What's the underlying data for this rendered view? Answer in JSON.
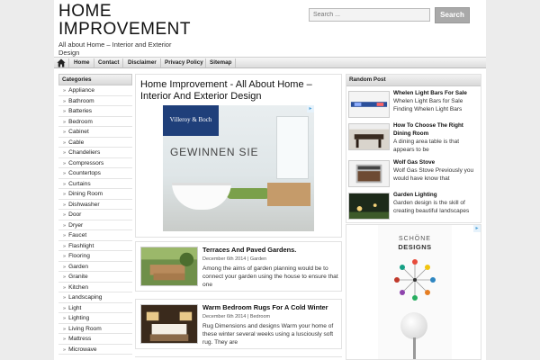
{
  "header": {
    "site_title": "HOME IMPROVEMENT",
    "tagline": "All about Home – Interior and Exterior Design"
  },
  "search": {
    "placeholder": "Search ...",
    "button_label": "Search"
  },
  "nav": {
    "home_icon": "home-icon",
    "items": [
      "Home",
      "Contact",
      "Disclaimer",
      "Privacy Policy",
      "Sitemap"
    ]
  },
  "categories": {
    "heading": "Categories",
    "items": [
      "Appliance",
      "Bathroom",
      "Batteries",
      "Bedroom",
      "Cabinet",
      "Cable",
      "Chandeliers",
      "Compressors",
      "Countertops",
      "Curtains",
      "Dining Room",
      "Dishwasher",
      "Door",
      "Dryer",
      "Faucet",
      "Flashlight",
      "Flooring",
      "Garden",
      "Granite",
      "Kitchen",
      "Landscaping",
      "Light",
      "Lighting",
      "Living Room",
      "Mattress",
      "Microwave"
    ]
  },
  "featured": {
    "title": "Home Improvement - All About Home – Interior And Exterior Design",
    "ad_brand": "Villeroy & Boch",
    "ad_text": "GEWINNEN SIE"
  },
  "posts": [
    {
      "title": "Terraces And Paved Gardens.",
      "date": "December 6th 2014",
      "category": "Garden",
      "excerpt": "Among the aims of garden planning would be to connect your garden using the house to ensure that one"
    },
    {
      "title": "Warm Bedroom Rugs For A Cold Winter",
      "date": "December 6th 2014",
      "category": "Bedroom",
      "excerpt": "Rug Dimensions and designs Warm your home of these winter several weeks using a lusciously soft rug. They are"
    }
  ],
  "random_post": {
    "heading": "Random Post",
    "items": [
      {
        "title": "Whelen Light Bars For Sale",
        "text": "Whelen Light Bars for Sale Finding Whelen Light Bars"
      },
      {
        "title": "How To Choose The Right Dining Room",
        "text": "A dining area table is that appears to be"
      },
      {
        "title": "Wolf Gas Stove",
        "text": "Wolf Gas Stove Previously you would have know that"
      },
      {
        "title": "Garden Lighting",
        "text": "Garden design is the skill of creating beautiful landscapes"
      }
    ]
  },
  "ad2": {
    "line1": "SCHÖNE",
    "line2": "DESIGNS"
  },
  "colors": {
    "background": "#ececec",
    "ad_brand_blue": "#1f3f7a",
    "search_button": "#a9a9a9"
  }
}
